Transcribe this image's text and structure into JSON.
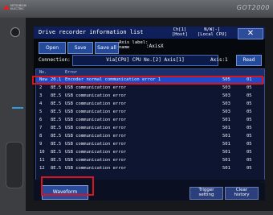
{
  "device": {
    "logo_text": "MITSUBISHI\nELECTRIC",
    "brand": "GOT2000"
  },
  "window": {
    "title": "Drive recorder information list",
    "ch_info": "Ch[1]\n[Host]",
    "nw_info": "N/W[-]\n[Local CPU]",
    "close_label": "✕"
  },
  "toolbar": {
    "open_label": "Open",
    "save_label": "Save",
    "save_all_label": "Save all",
    "axis_label": "Axis label:\nname",
    "axis_name": ":AxisX"
  },
  "connection": {
    "label": "Connection:",
    "value": "Via[CPU] CPU No.[2] Axis[1]",
    "axis": "Axis:1",
    "read_label": "Read"
  },
  "table": {
    "headers": [
      "No.",
      "",
      "Error",
      "",
      ""
    ],
    "rows": [
      {
        "no": "New",
        "code": "20.1",
        "text": "Encoder normal communication error 1",
        "c1": "505",
        "c2": "01",
        "selected": true
      },
      {
        "no": "2",
        "code": "8E.5",
        "text": "USB communication error",
        "c1": "503",
        "c2": "05"
      },
      {
        "no": "3",
        "code": "8E.5",
        "text": "USB communication error",
        "c1": "503",
        "c2": "05"
      },
      {
        "no": "4",
        "code": "8E.5",
        "text": "USB communication error",
        "c1": "503",
        "c2": "05"
      },
      {
        "no": "5",
        "code": "8E.5",
        "text": "USB communication error",
        "c1": "503",
        "c2": "05"
      },
      {
        "no": "6",
        "code": "8E.5",
        "text": "USB communication error",
        "c1": "501",
        "c2": "05"
      },
      {
        "no": "7",
        "code": "8E.5",
        "text": "USB communication error",
        "c1": "501",
        "c2": "05"
      },
      {
        "no": "8",
        "code": "8E.5",
        "text": "USB communication error",
        "c1": "501",
        "c2": "05"
      },
      {
        "no": "9",
        "code": "8E.5",
        "text": "USB communication error",
        "c1": "501",
        "c2": "05"
      },
      {
        "no": "10",
        "code": "8E.5",
        "text": "USB communication error",
        "c1": "501",
        "c2": "05"
      },
      {
        "no": "11",
        "code": "8E.5",
        "text": "USB communication error",
        "c1": "501",
        "c2": "05"
      },
      {
        "no": "12",
        "code": "8E.5",
        "text": "USB communication error",
        "c1": "501",
        "c2": "05"
      }
    ]
  },
  "footer": {
    "waveform_label": "Waveform",
    "trigger_label": "Trigger\nsetting",
    "clear_label": "Clear\nhistory"
  },
  "colors": {
    "title_bar": "#0f1f5a",
    "button": "#244a9c",
    "selection": "#1e4bc9",
    "highlight_ring": "#d8141c"
  }
}
